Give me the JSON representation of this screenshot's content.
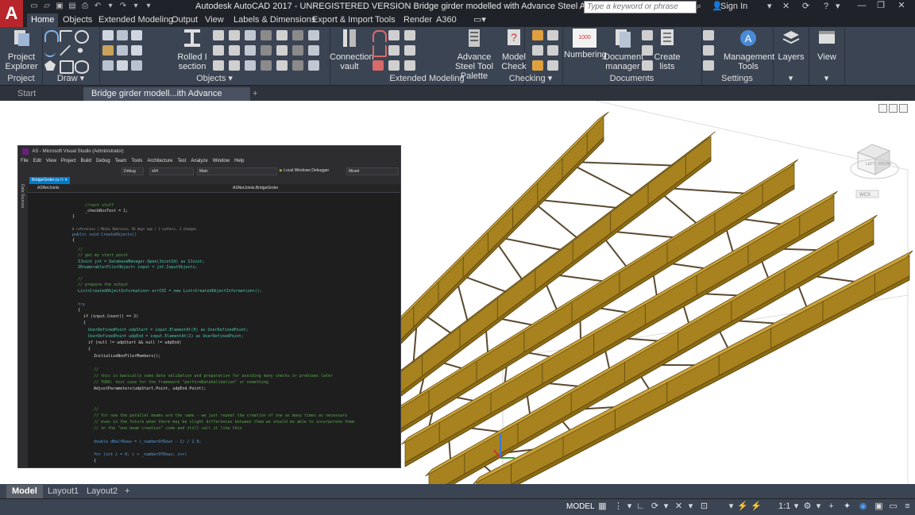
{
  "app": {
    "title": "Autodesk AutoCAD 2017 - UNREGISTERED VERSION   Bridge girder modelled with Advance Steel API.dwg",
    "logo": "A",
    "search_placeholder": "Type a keyword or phrase",
    "sign_in": "Sign In"
  },
  "menu_tabs": [
    "Home",
    "Objects",
    "Extended Modeling",
    "Output",
    "View",
    "Labels & Dimensions",
    "Export & Import",
    "Tools",
    "Render",
    "A360"
  ],
  "ribbon": {
    "panels": {
      "project": "Project",
      "draw": "Draw",
      "objects": "Objects",
      "extended_modeling": "Extended Modeling",
      "checking": "Checking",
      "documents": "Documents",
      "settings": "Settings"
    },
    "buttons": {
      "project_explorer": "Project Explorer",
      "rolled_isection": "Rolled I section",
      "connection_vault": "Connection vault",
      "tool_palette": "Advance Steel Tool Palette",
      "model_check": "Model Check",
      "numbering": "Numbering",
      "document_manager": "Document manager",
      "create_lists": "Create lists",
      "management_tools": "Management Tools",
      "layers": "Layers",
      "view": "View"
    },
    "numbering_badge": "1000"
  },
  "doc_tabs": [
    "Start",
    "Bridge girder modell...ith Advance Steel API"
  ],
  "visual_studio": {
    "title": "AS - Microsoft Visual Studio (Administrator)",
    "menu": [
      "File",
      "Edit",
      "View",
      "Project",
      "Build",
      "Debug",
      "Team",
      "Tools",
      "Architecture",
      "Test",
      "Analyze",
      "Window",
      "Help"
    ],
    "config": "Debug",
    "platform": "x64",
    "startup": "Main",
    "debugger": "Local Windows Debugger",
    "mixed": "Mixed",
    "side_label": "Data Sources",
    "file_tab": "BridgeGirder.cs",
    "nav_left": "ASNetJoints",
    "nav_right": "ASNetJoints.BridgeGirder",
    "codelens": "0 references | Mihai Dobresco, 56 days ago | 2 authors, 3 changes",
    "code": [
      "//test stuff",
      "_checkBoxTest = 1;",
      "}",
      "public void CreateObjects()",
      "{",
      "//",
      "// get my start point",
      "IJoint jnt = DatabaseManager.Open(JointId) as IJoint;",
      "IEnumerable<FilerObject> input = jnt.InputObjects;",
      "//",
      "// prepare the output",
      "List<CreatedObjectInformation> arrCOI = new List<CreatedObjectInformation>();",
      "try",
      "{",
      "if (input.Count() == 2)",
      "{",
      "UserDefinedPoint udpStart = input.ElementAt(0) as UserDefinedPoint;",
      "UserDefinedPoint udpEnd = input.ElementAt(1) as UserDefinedPoint;",
      "if (null != udpStart && null != udpEnd)",
      "{",
      "InitializeNonFilerMembers();",
      "//",
      "// this is basically some data validation and preparation for avoiding many checks or problems later",
      "// TODO: test case for the framework \"performDataValidation\" or something",
      "AdjustParameters(udpStart.Point, udpEnd.Point);",
      "//",
      "// for now the parallel beams are the same - we just repeat the creation of one as many times as necessary",
      "// even in the future when there may be slight differences between them we should be able to incorporate them",
      "// in the \"one beam creation\" code and still call it like this",
      "double dHalfRows = (_numberOfRows - 1) / 2.0;",
      "for (int i = 0; i < _numberOfRows; i++)",
      "{"
    ]
  },
  "viewcube": {
    "left": "LEFT",
    "front": "FRONT",
    "wcs": "WCS"
  },
  "layout_tabs": [
    "Model",
    "Layout1",
    "Layout2"
  ],
  "status": {
    "model": "MODEL",
    "scale": "1:1"
  }
}
